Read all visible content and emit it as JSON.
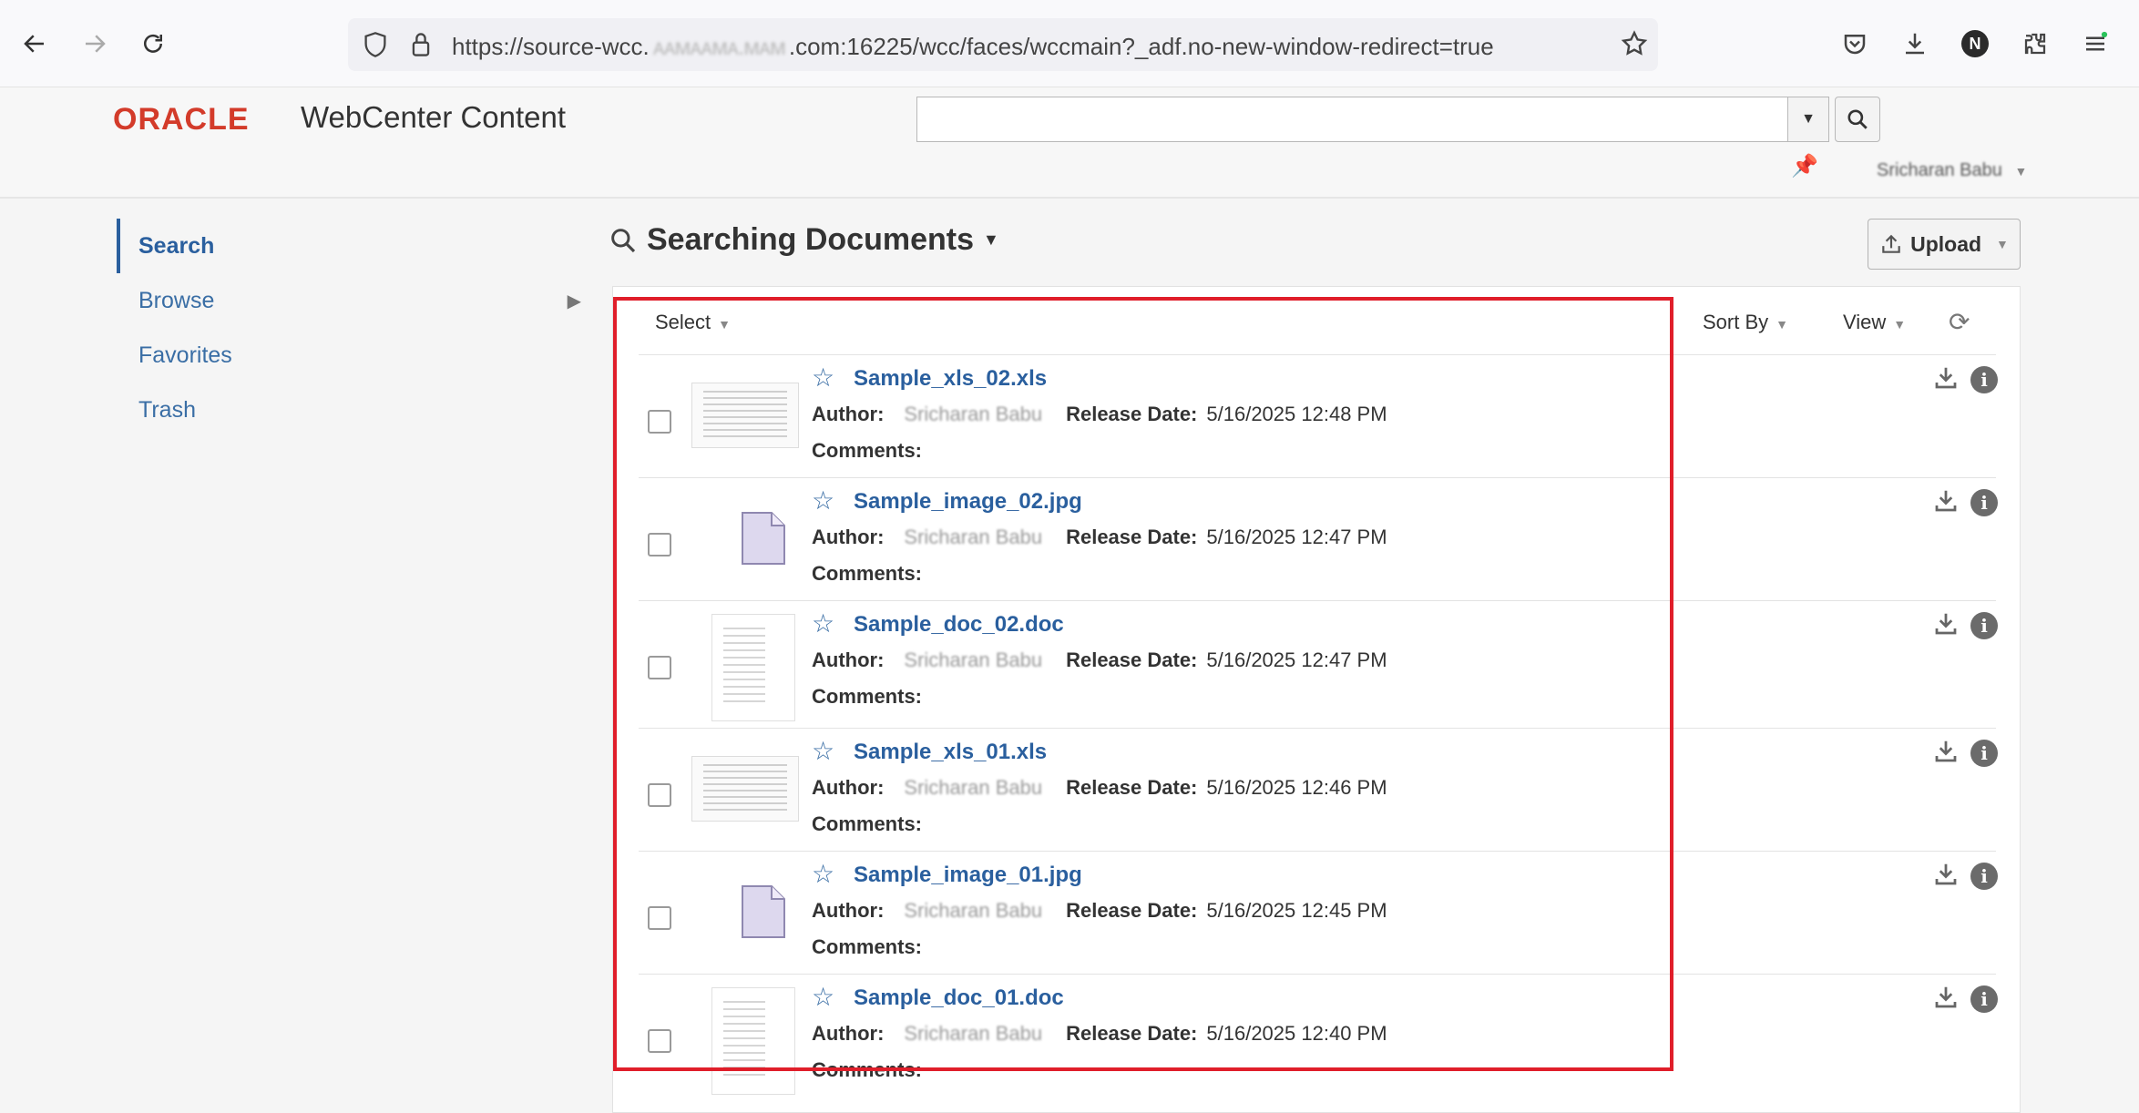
{
  "browser": {
    "url_prefix": "https://source-wcc.",
    "url_redacted": "ᴀᴀᴍᴀᴀᴍᴀ.ᴍᴀᴍ",
    "url_suffix": ".com:16225/wcc/faces/wccmain?_adf.no-new-window-redirect=true",
    "profile_initial": "N"
  },
  "header": {
    "logo": "ORACLE",
    "product": "WebCenter Content",
    "search_value": "",
    "user_name": "Sricharan Babu"
  },
  "nav": {
    "items": [
      {
        "label": "Search"
      },
      {
        "label": "Browse"
      },
      {
        "label": "Favorites"
      },
      {
        "label": "Trash"
      }
    ]
  },
  "main": {
    "title": "Searching Documents",
    "upload_label": "Upload",
    "select_label": "Select",
    "sort_label": "Sort By",
    "view_label": "View"
  },
  "labels": {
    "author": "Author:",
    "release_date": "Release Date:",
    "comments": "Comments:"
  },
  "documents": [
    {
      "name": "Sample_xls_02.xls",
      "author": "Sricharan Babu",
      "release_date": "5/16/2025 12:48 PM",
      "thumb": "sheet"
    },
    {
      "name": "Sample_image_02.jpg",
      "author": "Sricharan Babu",
      "release_date": "5/16/2025 12:47 PM",
      "thumb": "file"
    },
    {
      "name": "Sample_doc_02.doc",
      "author": "Sricharan Babu",
      "release_date": "5/16/2025 12:47 PM",
      "thumb": "doc"
    },
    {
      "name": "Sample_xls_01.xls",
      "author": "Sricharan Babu",
      "release_date": "5/16/2025 12:46 PM",
      "thumb": "sheet"
    },
    {
      "name": "Sample_image_01.jpg",
      "author": "Sricharan Babu",
      "release_date": "5/16/2025 12:45 PM",
      "thumb": "file"
    },
    {
      "name": "Sample_doc_01.doc",
      "author": "Sricharan Babu",
      "release_date": "5/16/2025 12:40 PM",
      "thumb": "doc"
    }
  ],
  "colors": {
    "highlight": "#e01e2a",
    "link": "#2a5f9e",
    "oracle_red": "#d33b2a"
  }
}
